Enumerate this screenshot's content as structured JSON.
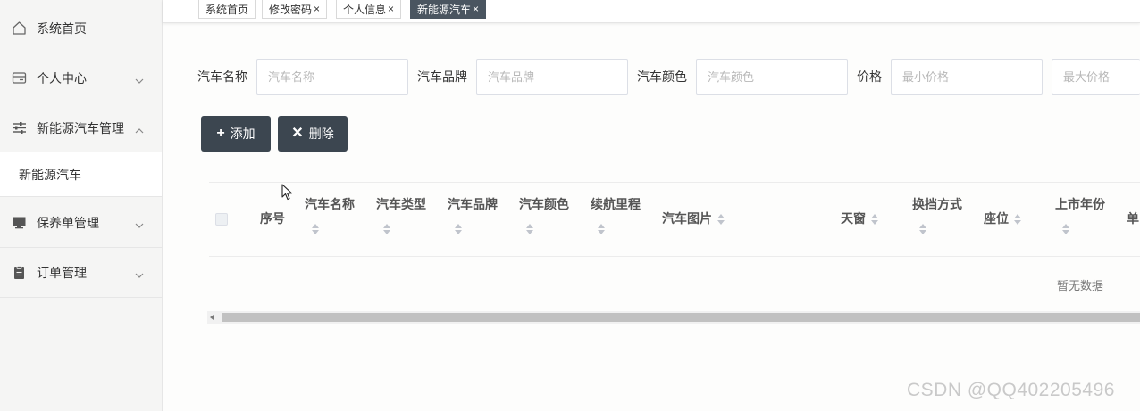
{
  "sidebar": {
    "items": [
      {
        "label": "系统首页",
        "icon": "home-icon"
      },
      {
        "label": "个人中心",
        "icon": "card-icon"
      },
      {
        "label": "新能源汽车管理",
        "icon": "sliders-icon"
      },
      {
        "label": "保养单管理",
        "icon": "monitor-icon"
      },
      {
        "label": "订单管理",
        "icon": "clipboard-icon"
      }
    ],
    "submenu": {
      "label": "新能源汽车"
    }
  },
  "tabs": [
    {
      "label": "系统首页",
      "closable": false
    },
    {
      "label": "修改密码",
      "closable": true,
      "close": "×"
    },
    {
      "label": "个人信息",
      "closable": true,
      "close": "×"
    },
    {
      "label": "新能源汽车",
      "closable": true,
      "close": "×",
      "active": true
    }
  ],
  "filters": {
    "name_label": "汽车名称",
    "name_placeholder": "汽车名称",
    "brand_label": "汽车品牌",
    "brand_placeholder": "汽车品牌",
    "color_label": "汽车颜色",
    "color_placeholder": "汽车颜色",
    "price_label": "价格",
    "min_price_placeholder": "最小价格",
    "max_price_placeholder": "最大价格"
  },
  "actions": {
    "add_label": "添加",
    "add_icon": "+",
    "delete_label": "删除",
    "delete_icon": "✕"
  },
  "table": {
    "columns": [
      {
        "label": "序号"
      },
      {
        "label": "汽车名称"
      },
      {
        "label": "汽车类型"
      },
      {
        "label": "汽车品牌"
      },
      {
        "label": "汽车颜色"
      },
      {
        "label": "续航里程"
      },
      {
        "label": "汽车图片"
      },
      {
        "label": "天窗"
      },
      {
        "label": "换挡方式"
      },
      {
        "label": "座位"
      },
      {
        "label": "上市年份"
      },
      {
        "label": "单"
      }
    ],
    "empty_text": "暂无数据"
  },
  "watermark": "CSDN @QQ402205496",
  "colors": {
    "sidebar_bg": "#f5f5f4",
    "active_tab_bg": "#4a5560",
    "button_bg": "#3c4650"
  }
}
